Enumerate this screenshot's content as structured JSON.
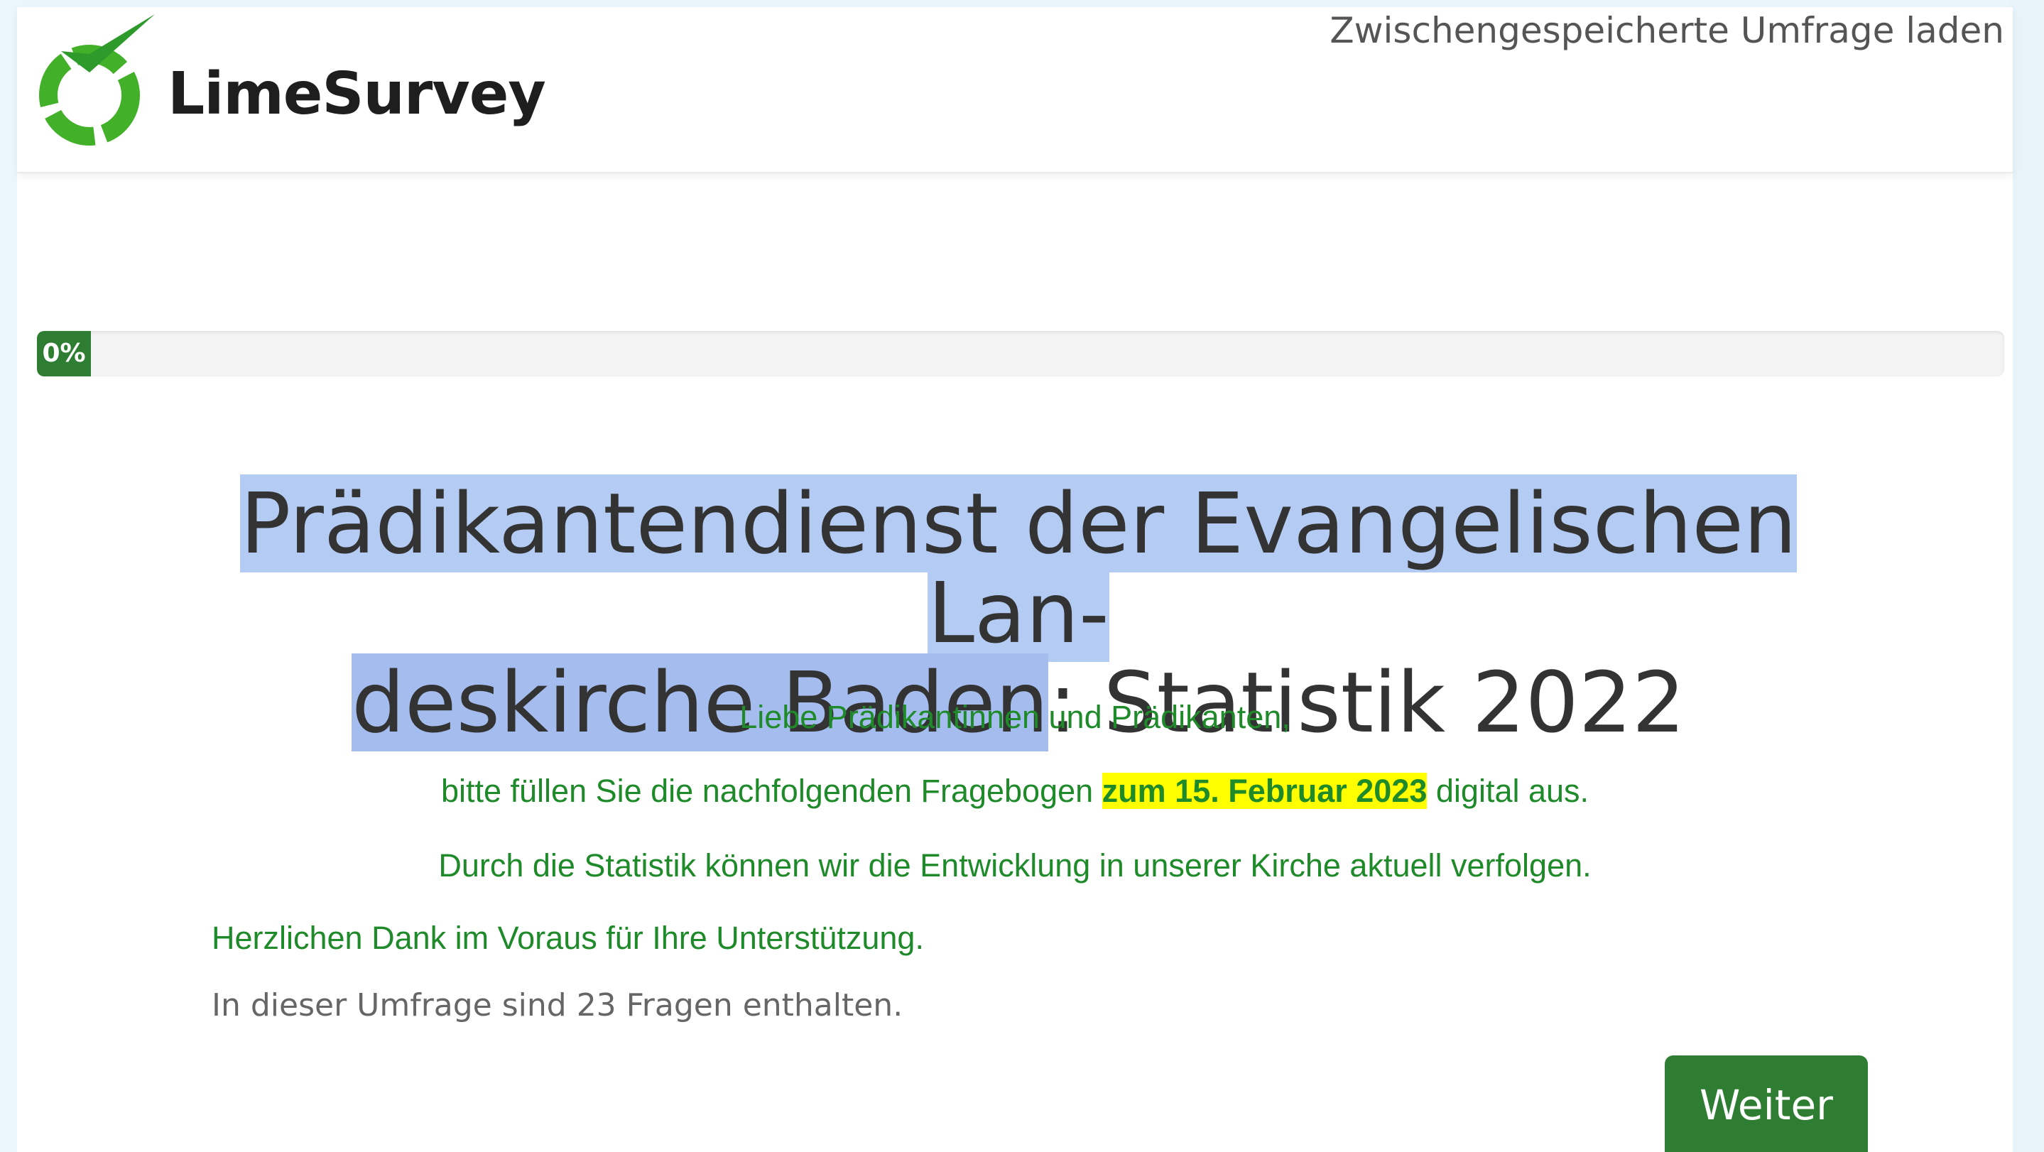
{
  "header": {
    "brand_name": "LimeSurvey",
    "load_saved_label": "Zwischengespeicherte Umfrage laden"
  },
  "progress": {
    "value_percent": 0,
    "label": "0%",
    "fill_color": "#2e7d32"
  },
  "survey": {
    "title_part1": "Prädikantendienst der Evangelischen Lan-",
    "title_part2_selected": "deskirche Baden",
    "title_part2_rest": ": Statistik 2022",
    "greeting": "Liebe Prädikantinnen und Prädikanten,",
    "instruction_before": "bitte füllen Sie die nachfolgenden Fragebogen ",
    "instruction_highlight": "zum 15. Februar 2023",
    "instruction_after": " digital aus.",
    "purpose": "Durch die Statistik können wir die Entwicklung in unserer Kirche aktuell verfolgen.",
    "thanks": "Herzlichen Dank im Voraus für Ihre Unterstützung.",
    "question_count_text": "In dieser Umfrage sind 23 Fragen enthalten."
  },
  "actions": {
    "next_label": "Weiter"
  },
  "colors": {
    "brand_green": "#2e7d32",
    "intro_text_green": "#1f8a2a",
    "highlight_yellow": "#ffff00",
    "selection_blue": "#b4cbf3"
  }
}
